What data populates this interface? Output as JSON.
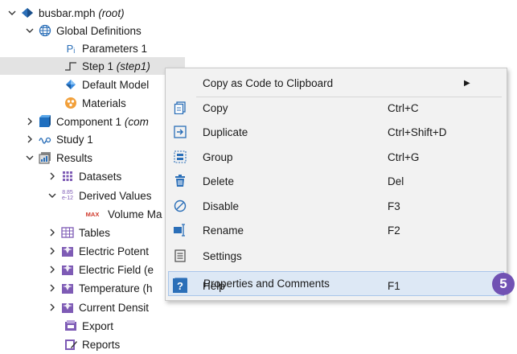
{
  "tree": {
    "root": {
      "name": "busbar.mph",
      "suffix": "(root)"
    },
    "global_definitions": "Global Definitions",
    "parameters": {
      "icon_text": "Pᵢ",
      "label": "Parameters 1"
    },
    "step": {
      "name": "Step 1",
      "suffix": "(step1)"
    },
    "default_model": "Default Model",
    "materials": "Materials",
    "component": {
      "name": "Component 1",
      "suffix": "(com"
    },
    "study": "Study 1",
    "results": "Results",
    "datasets": "Datasets",
    "derived_values": {
      "icon_text_top": "8.85",
      "icon_text_bottom": "e-12",
      "label": "Derived Values"
    },
    "volume_max": {
      "icon_text": "MAX",
      "label": "Volume Ma"
    },
    "tables": "Tables",
    "electric_potential": "Electric Potent",
    "electric_field": "Electric Field (e",
    "temperature": "Temperature (h",
    "current_density": "Current Densit",
    "export": "Export",
    "reports": "Reports"
  },
  "context_menu": {
    "copy_as_code": "Copy as Code to Clipboard",
    "copy": {
      "label": "Copy",
      "shortcut": "Ctrl+C"
    },
    "duplicate": {
      "label": "Duplicate",
      "shortcut": "Ctrl+Shift+D"
    },
    "group": {
      "label": "Group",
      "shortcut": "Ctrl+G"
    },
    "delete": {
      "label": "Delete",
      "shortcut": "Del"
    },
    "disable": {
      "label": "Disable",
      "shortcut": "F3"
    },
    "rename": {
      "label": "Rename",
      "shortcut": "F2"
    },
    "settings": {
      "label": "Settings"
    },
    "properties": {
      "label": "Properties and Comments"
    },
    "help": {
      "label": "Help",
      "shortcut": "F1"
    }
  },
  "callout": {
    "number": "5"
  },
  "colors": {
    "accent": "#7152b3",
    "hover": "#dde8f5",
    "selection": "#e3e3e3"
  }
}
